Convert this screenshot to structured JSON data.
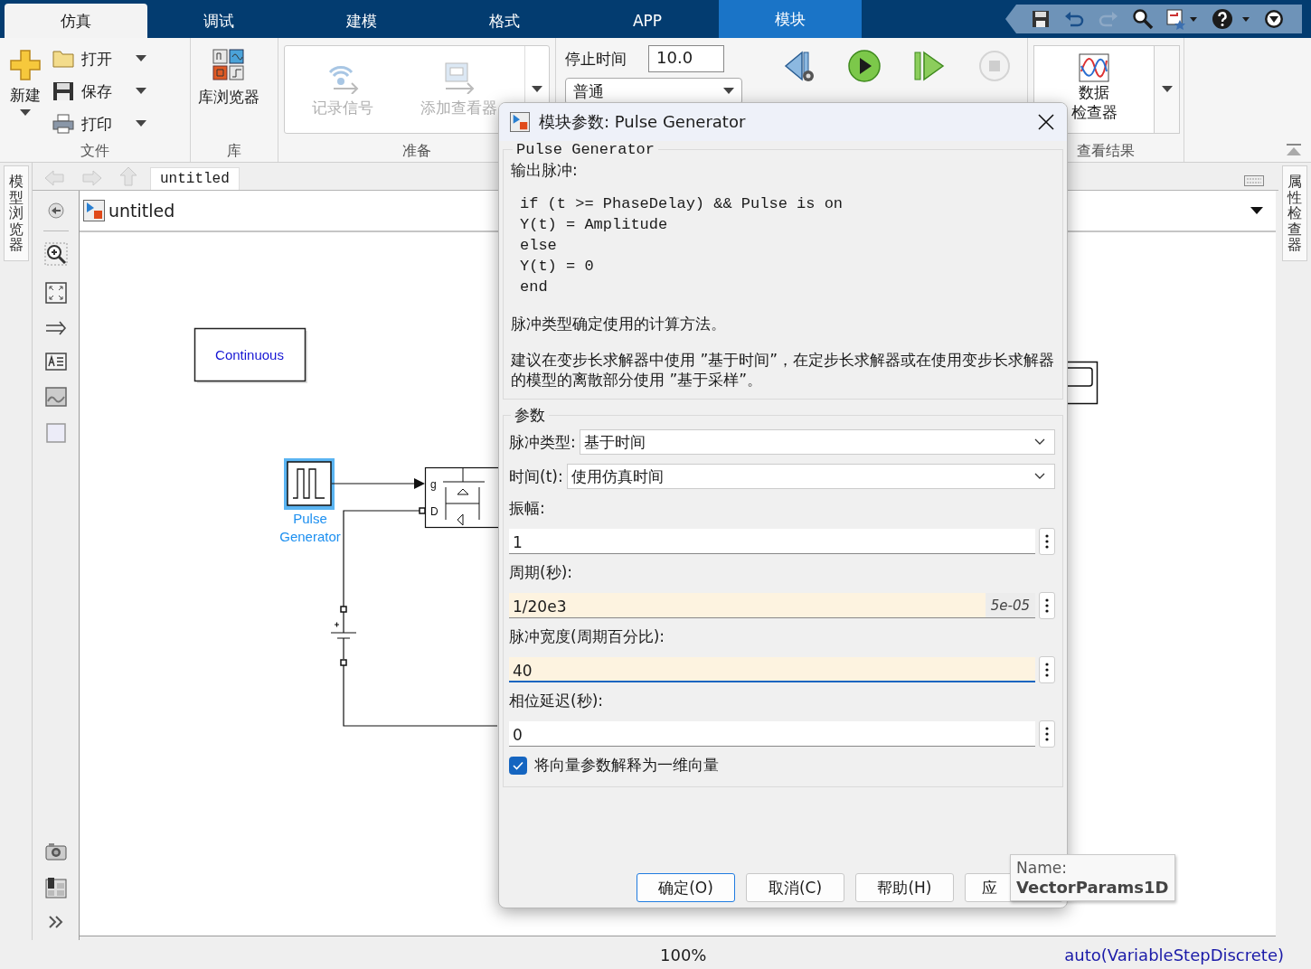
{
  "ribbon_tabs": [
    {
      "label": "仿真",
      "selected": true,
      "kind": "main"
    },
    {
      "label": "调试",
      "selected": false,
      "kind": "main"
    },
    {
      "label": "建模",
      "selected": false,
      "kind": "main"
    },
    {
      "label": "格式",
      "selected": false,
      "kind": "main"
    },
    {
      "label": "APP",
      "selected": false,
      "kind": "main"
    },
    {
      "label": "模块",
      "selected": false,
      "kind": "contextual"
    }
  ],
  "ribbon": {
    "file": {
      "new_label": "新建",
      "items": [
        {
          "label": "打开",
          "kind": "open"
        },
        {
          "label": "保存",
          "kind": "save"
        },
        {
          "label": "打印",
          "kind": "print"
        }
      ],
      "group_label": "文件"
    },
    "library": {
      "label": "库浏览器",
      "group_label": "库"
    },
    "prepare": {
      "items": [
        {
          "label": "记录信号",
          "kind": "log",
          "disabled": true
        },
        {
          "label": "添加查看器",
          "kind": "viewer",
          "disabled": true
        }
      ],
      "group_label": "准备"
    },
    "simulate": {
      "stop_time_label": "停止时间",
      "stop_time": "10.0",
      "mode": "普通",
      "actions": [
        {
          "kind": "step_back",
          "disabled": false
        },
        {
          "kind": "run",
          "disabled": false
        },
        {
          "kind": "step_forward",
          "disabled": false
        },
        {
          "kind": "stop",
          "disabled": true
        }
      ]
    },
    "review": {
      "label_lines": [
        "数据",
        "检查器"
      ],
      "group_label": "查看结果"
    }
  },
  "side_tabs": {
    "left": "模型浏览器",
    "right": "属性检查器"
  },
  "editor": {
    "breadcrumb_tab": "untitled",
    "address": "untitled",
    "canvas": {
      "solver_block": "Continuous",
      "pulse_block": {
        "label_lines": [
          "Pulse",
          "Generator"
        ],
        "selected": true
      },
      "mosfet_ports": [
        "g",
        "D"
      ]
    }
  },
  "status_bar": {
    "zoom": "100%",
    "solver": "auto(VariableStepDiscrete)"
  },
  "dialog": {
    "title": "模块参数: Pulse Generator",
    "block_name": "Pulse Generator",
    "description_title": "输出脉冲:",
    "code_lines": [
      "if (t >= PhaseDelay) && Pulse is on",
      "Y(t) = Amplitude",
      "else",
      "Y(t) = 0",
      "end"
    ],
    "notes": [
      "脉冲类型确定使用的计算方法。",
      "建议在变步长求解器中使用 ”基于时间”，在定步长求解器或在使用变步长求解器的模型的离散部分使用 ”基于采样”。"
    ],
    "params_title": "参数",
    "params": [
      {
        "kind": "dropdown",
        "label": "脉冲类型:",
        "value": "基于时间"
      },
      {
        "kind": "dropdown",
        "label": "时间(t):",
        "value": "使用仿真时间"
      },
      {
        "kind": "field",
        "label": "振幅:",
        "value": "1",
        "modified": false,
        "focused": false
      },
      {
        "kind": "field",
        "label": "周期(秒):",
        "value": "1/20e3",
        "evaluated": "5e-05",
        "modified": true,
        "focused": false
      },
      {
        "kind": "field",
        "label": "脉冲宽度(周期百分比):",
        "value": "40",
        "modified": true,
        "focused": true
      },
      {
        "kind": "field",
        "label": "相位延迟(秒):",
        "value": "0",
        "modified": false,
        "focused": false
      },
      {
        "kind": "checkbox",
        "label": "将向量参数解释为一维向量",
        "checked": true
      }
    ],
    "buttons": [
      {
        "label": "确定(O)",
        "default": true
      },
      {
        "label": "取消(C)",
        "default": false
      },
      {
        "label": "帮助(H)",
        "default": false
      },
      {
        "label": "应",
        "default": false
      }
    ]
  },
  "tooltip": {
    "label": "Name:",
    "value": "VectorParams1D"
  }
}
